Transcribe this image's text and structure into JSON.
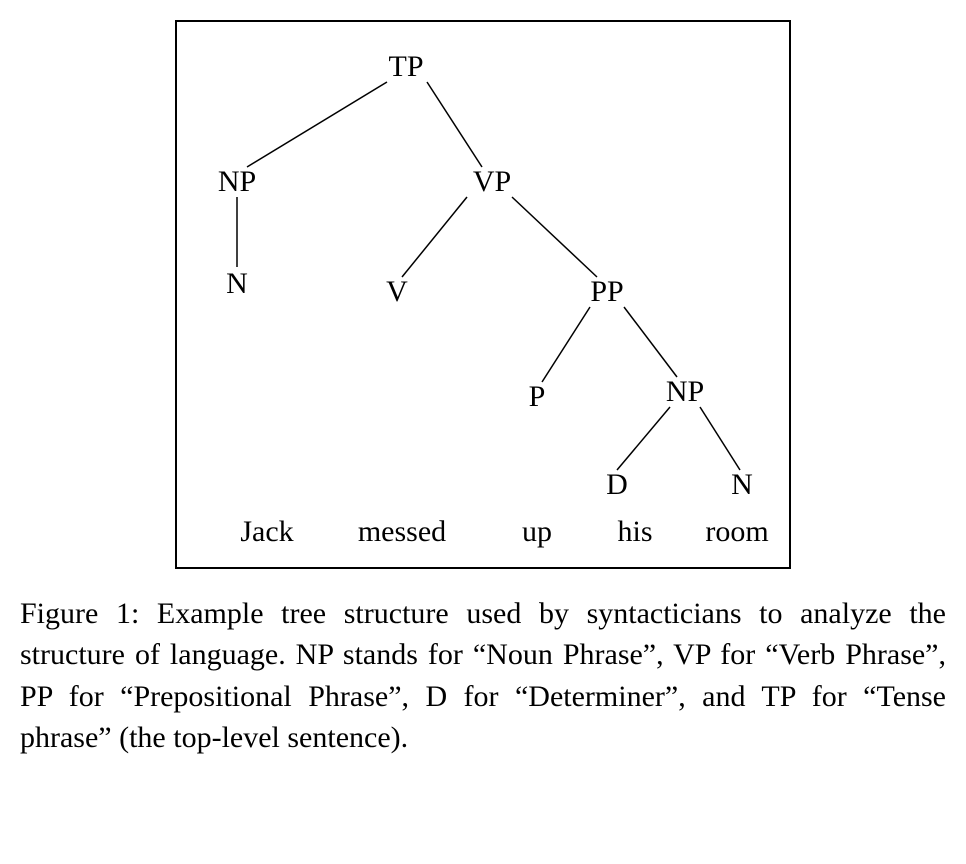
{
  "tree": {
    "nodes": {
      "tp": "TP",
      "np1": "NP",
      "vp": "VP",
      "n1": "N",
      "v": "V",
      "pp": "PP",
      "p": "P",
      "np2": "NP",
      "d": "D",
      "n2": "N"
    },
    "words": {
      "w1": "Jack",
      "w2": "messed",
      "w3": "up",
      "w4": "his",
      "w5": "room"
    }
  },
  "caption": {
    "text": "Figure 1: Example tree structure used by syntacticians to analyze the structure of language. NP stands for “Noun Phrase”, VP for “Verb Phrase”, PP for “Prepositional Phrase”, D for “Determiner”, and TP for “Tense phrase” (the top-level sentence)."
  }
}
